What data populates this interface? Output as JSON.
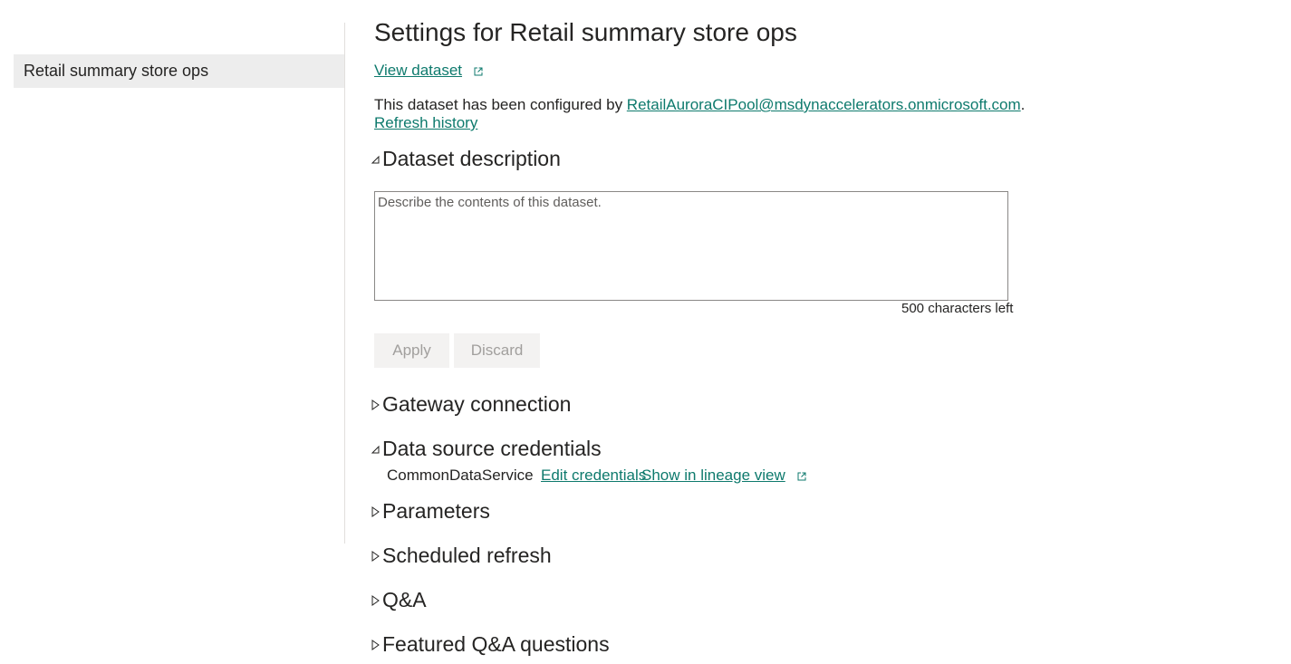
{
  "sidebar": {
    "items": [
      {
        "label": "Retail summary store ops"
      }
    ]
  },
  "main": {
    "title": "Settings for Retail summary store ops",
    "view_dataset": "View dataset",
    "config_text": "This dataset has been configured by ",
    "config_email": "RetailAuroraCIPool@msdynaccelerators.onmicrosoft.com",
    "config_period": ".",
    "refresh_history": "Refresh history",
    "sections": {
      "dataset_description": "Dataset description",
      "gateway_connection": "Gateway connection",
      "data_source_credentials": "Data source credentials",
      "parameters": "Parameters",
      "scheduled_refresh": "Scheduled refresh",
      "qna": "Q&A",
      "featured_qna": "Featured Q&A questions"
    },
    "description": {
      "placeholder": "Describe the contents of this dataset.",
      "value": "",
      "chars_left": "500 characters left"
    },
    "buttons": {
      "apply": "Apply",
      "discard": "Discard"
    },
    "credentials": {
      "source_name": "CommonDataService",
      "edit_label": "Edit credentials",
      "lineage_label": "Show in lineage view"
    }
  },
  "colors": {
    "link": "#0e7a6d",
    "sidebar_selected_bg": "#ededed",
    "text": "#252423",
    "button_bg": "#f3f2f1",
    "button_text_disabled": "#a19f9d"
  }
}
